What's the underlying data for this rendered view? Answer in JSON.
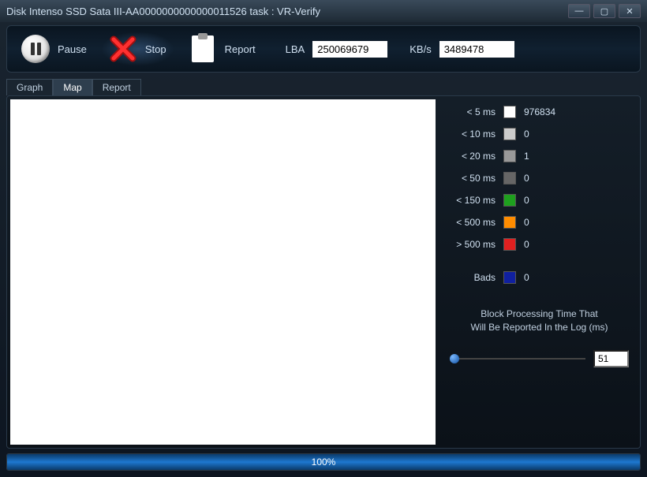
{
  "title": "Disk Intenso SSD Sata III-AA0000000000000011526   task : VR-Verify",
  "toolbar": {
    "pause": "Pause",
    "stop": "Stop",
    "report": "Report",
    "lba_label": "LBA",
    "lba_value": "250069679",
    "kbs_label": "KB/s",
    "kbs_value": "3489478"
  },
  "tabs": {
    "graph": "Graph",
    "map": "Map",
    "report": "Report",
    "active": "map"
  },
  "legend": [
    {
      "label": "< 5 ms",
      "color": "#ffffff",
      "count": "976834"
    },
    {
      "label": "< 10 ms",
      "color": "#cccccc",
      "count": "0"
    },
    {
      "label": "< 20 ms",
      "color": "#999999",
      "count": "1"
    },
    {
      "label": "< 50 ms",
      "color": "#666666",
      "count": "0"
    },
    {
      "label": "< 150 ms",
      "color": "#1ea01e",
      "count": "0"
    },
    {
      "label": "< 500 ms",
      "color": "#ff8c00",
      "count": "0"
    },
    {
      "label": "> 500 ms",
      "color": "#e02020",
      "count": "0"
    },
    {
      "label": "Bads",
      "color": "#1020a0",
      "count": "0"
    }
  ],
  "hint_line1": "Block Processing Time That",
  "hint_line2": "Will Be Reported In the Log (ms)",
  "slider_value": "51",
  "progress": {
    "percent": "100%",
    "width": "100%"
  }
}
